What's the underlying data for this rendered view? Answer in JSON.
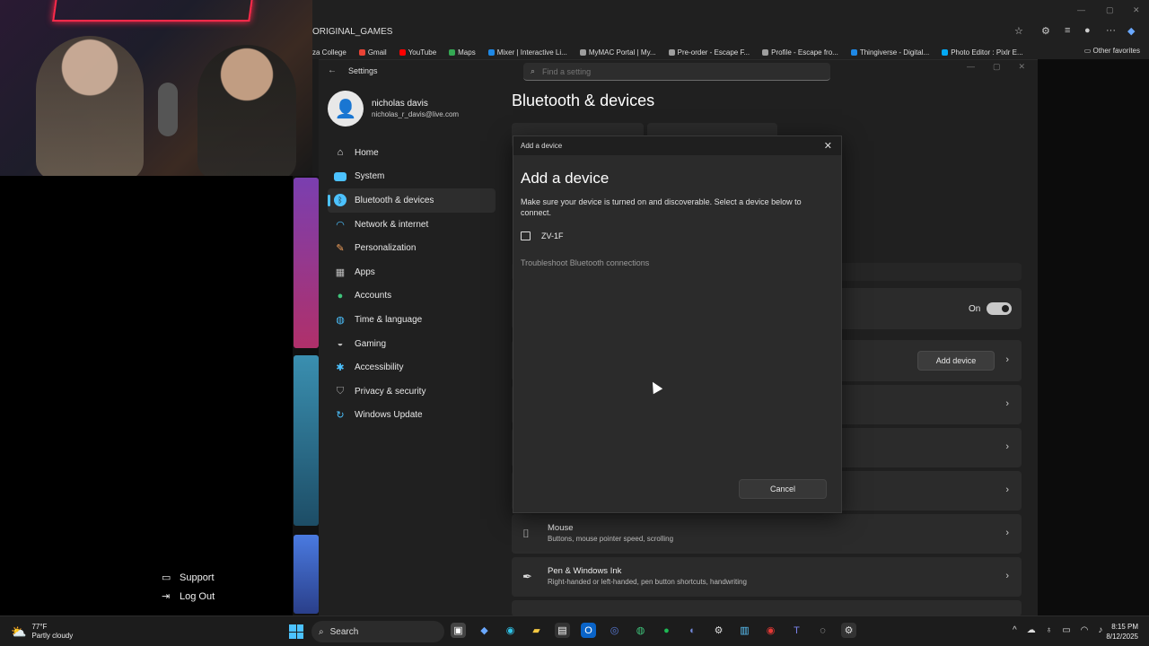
{
  "browser": {
    "tab_title": "ORIGINAL_GAMES",
    "bookmarks": [
      "za College",
      "Gmail",
      "YouTube",
      "Maps",
      "Mixer | Interactive Li...",
      "MyMAC Portal | My...",
      "Pre-order - Escape F...",
      "Profile - Escape fro...",
      "Thingiverse - Digital...",
      "Photo Editor : Pixlr E..."
    ],
    "bookmark_colors": [
      "#4caf50",
      "#ea4335",
      "#ff0000",
      "#34a853",
      "#1e88e5",
      "#9e9e9e",
      "#9e9e9e",
      "#9e9e9e",
      "#1e88e5",
      "#03a9f4"
    ],
    "other_favorites": "Other favorites"
  },
  "left_panel": {
    "support": "Support",
    "log_out": "Log Out"
  },
  "settings": {
    "window_title": "Settings",
    "search_placeholder": "Find a setting",
    "user_name": "nicholas davis",
    "user_email": "nicholas_r_davis@live.com",
    "page_title": "Bluetooth & devices",
    "nav": [
      {
        "label": "Home",
        "icon": "home-icon",
        "color": "#e8e8e8"
      },
      {
        "label": "System",
        "icon": "monitor-icon",
        "color": "#4cc2ff"
      },
      {
        "label": "Bluetooth & devices",
        "icon": "bluetooth-icon",
        "color": "#4cc2ff"
      },
      {
        "label": "Network & internet",
        "icon": "wifi-icon",
        "color": "#4cc2ff"
      },
      {
        "label": "Personalization",
        "icon": "brush-icon",
        "color": "#f7a35c"
      },
      {
        "label": "Apps",
        "icon": "apps-icon",
        "color": "#bdbdbd"
      },
      {
        "label": "Accounts",
        "icon": "account-icon",
        "color": "#3fc47b"
      },
      {
        "label": "Time & language",
        "icon": "globe-clock-icon",
        "color": "#4cc2ff"
      },
      {
        "label": "Gaming",
        "icon": "gamepad-icon",
        "color": "#bdbdbd"
      },
      {
        "label": "Accessibility",
        "icon": "accessibility-icon",
        "color": "#4cc2ff"
      },
      {
        "label": "Privacy & security",
        "icon": "shield-icon",
        "color": "#9e9e9e"
      },
      {
        "label": "Windows Update",
        "icon": "update-icon",
        "color": "#4cc2ff"
      }
    ],
    "toggle_label": "On",
    "add_device_label": "Add device",
    "mouse_title": "Mouse",
    "mouse_desc": "Buttons, mouse pointer speed, scrolling",
    "pen_title": "Pen & Windows Ink",
    "pen_desc": "Right-handed or left-handed, pen button shortcuts, handwriting"
  },
  "dialog": {
    "window_title": "Add a device",
    "heading": "Add a device",
    "description": "Make sure your device is turned on and discoverable. Select a device below to connect.",
    "device_name": "ZV-1F",
    "troubleshoot": "Troubleshoot Bluetooth connections",
    "cancel_label": "Cancel"
  },
  "taskbar": {
    "temperature": "77°F",
    "weather": "Partly cloudy",
    "search_label": "Search",
    "time": "8:15 PM",
    "date": "8/12/2025"
  }
}
